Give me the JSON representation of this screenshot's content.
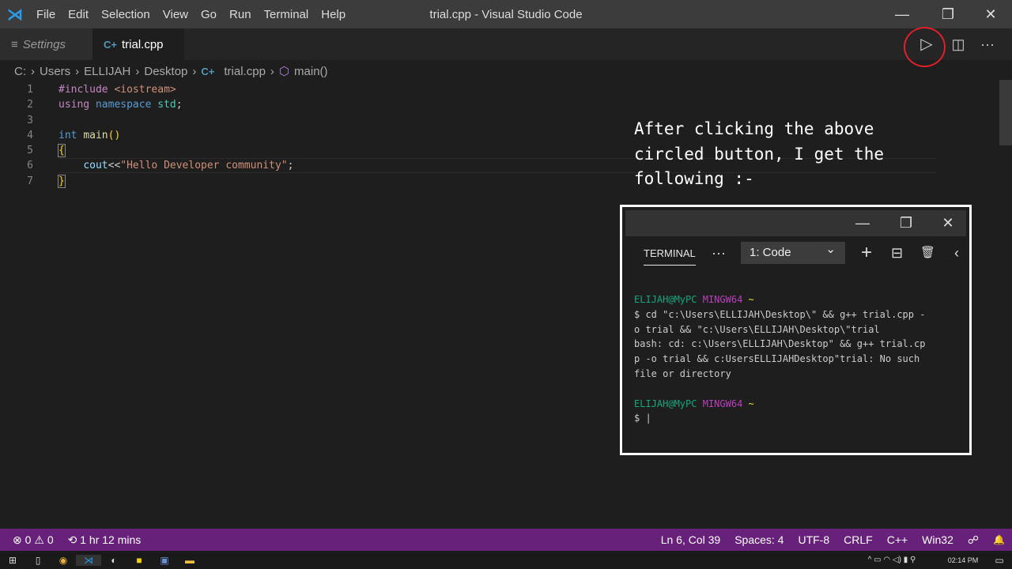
{
  "window": {
    "title": "trial.cpp - Visual Studio Code",
    "minimize": "—",
    "restore": "❐",
    "close": "✕"
  },
  "menu": [
    "File",
    "Edit",
    "Selection",
    "View",
    "Go",
    "Run",
    "Terminal",
    "Help"
  ],
  "tabs": [
    {
      "label": "Settings"
    },
    {
      "label": "trial.cpp",
      "close": "✕"
    }
  ],
  "toolbar": {
    "run": "▷",
    "split": "◫",
    "more": "···"
  },
  "breadcrumb": [
    "C:",
    "Users",
    "ELLIJAH",
    "Desktop",
    "trial.cpp",
    "main()"
  ],
  "code": {
    "line_numbers": [
      "1",
      "2",
      "3",
      "4",
      "5",
      "6",
      "7"
    ],
    "l1a": "#include ",
    "l1b": "<iostream>",
    "l2a": "using ",
    "l2b": "namespace ",
    "l2c": "std",
    ";": ";",
    "l4a": "int ",
    "l4b": "main",
    "l4c": "()",
    "l5": "{",
    "l6a": "    ",
    "l6b": "cout",
    "l6c": "<<",
    "l6d": "\"Hello Developer community\"",
    "l6e": ";",
    "l7": "}"
  },
  "annotation": "After clicking the above circled button, I get the following :-",
  "terminal": {
    "minimize": "—",
    "restore": "❐",
    "close": "✕",
    "tab": "TERMINAL",
    "more": "···",
    "selected": "1: Code",
    "chevron": "⌄",
    "add": "+",
    "split": "⊟",
    "trash": "🗑",
    "collapse": "‹",
    "prompt_user": "ELIJAH@MyPC",
    "prompt_env": "MINGW64",
    "prompt_dir": "~",
    "cmd": "$ cd \"c:\\Users\\ELLIJAH\\Desktop\\\" && g++ trial.cpp -\no trial && \"c:\\Users\\ELLIJAH\\Desktop\\\"trial",
    "error": "bash: cd: c:\\Users\\ELLIJAH\\Desktop\" && g++ trial.cp\np -o trial && c:UsersELLIJAHDesktop\"trial: No such\nfile or directory",
    "prompt2": "$ |"
  },
  "status": {
    "errors": "⊗ 0",
    "warnings": "⚠ 0",
    "time": "⟲ 1 hr 12 mins",
    "position": "Ln 6, Col 39",
    "spaces": "Spaces: 4",
    "encoding": "UTF-8",
    "eol": "CRLF",
    "language": "C++",
    "platform": "Win32",
    "feedback": "☍",
    "bell": "🔔"
  },
  "taskbar": {
    "clock": "02:14 PM"
  }
}
